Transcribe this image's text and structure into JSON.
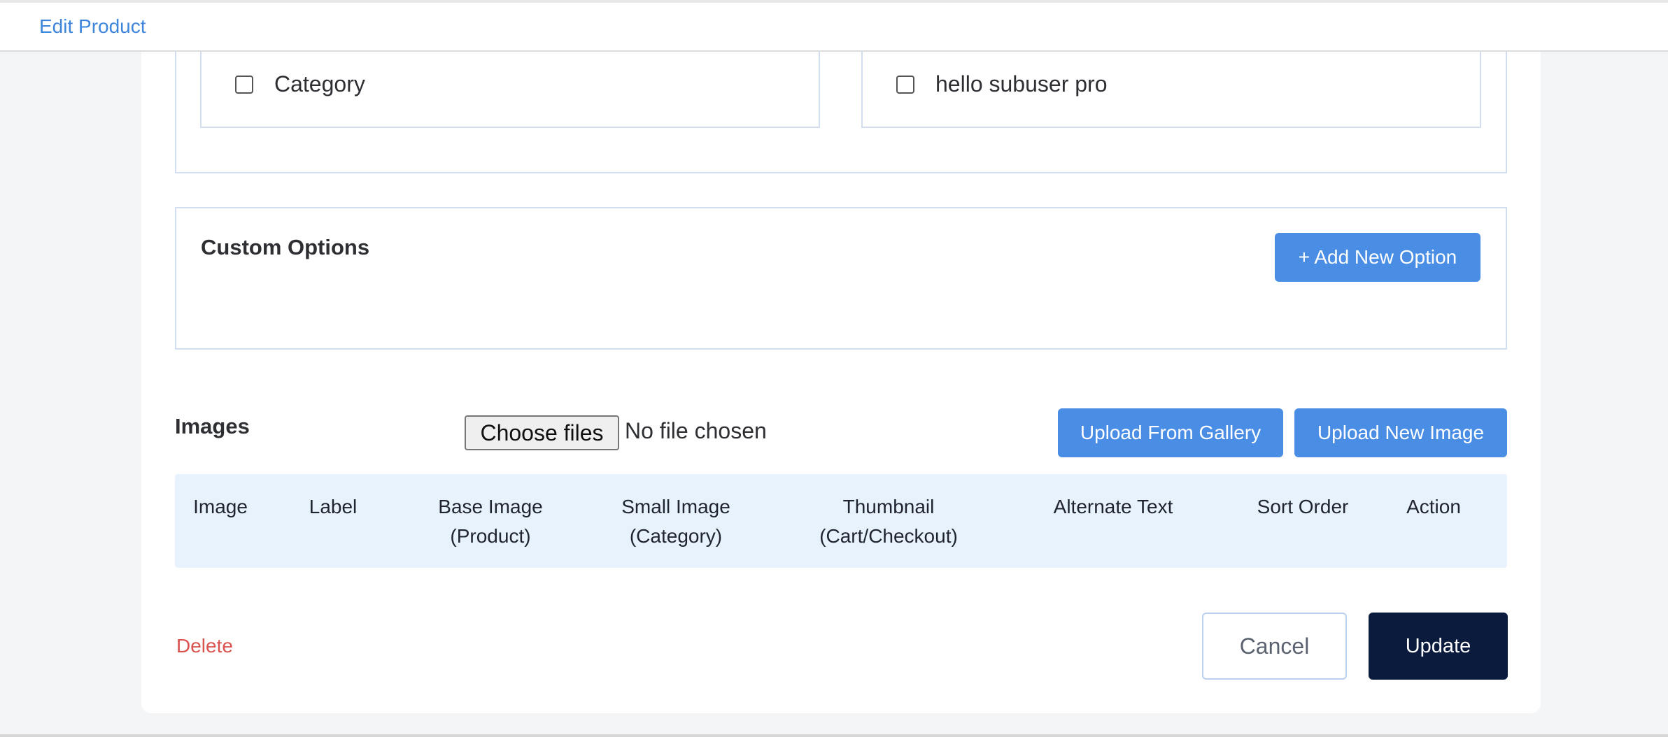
{
  "header": {
    "breadcrumb": "Edit Product"
  },
  "categories": {
    "items": [
      {
        "label": "Category",
        "checked": false
      },
      {
        "label": "hello subuser pro",
        "checked": false
      }
    ]
  },
  "custom_options": {
    "title": "Custom Options",
    "add_button": "+ Add New Option"
  },
  "images": {
    "title": "Images",
    "file_button": "Choose files",
    "file_status": "No file chosen",
    "upload_gallery_button": "Upload From Gallery",
    "upload_new_button": "Upload New Image",
    "columns": [
      "Image",
      "Label",
      "Base Image\n(Product)",
      "Small Image\n(Category)",
      "Thumbnail\n(Cart/Checkout)",
      "Alternate Text",
      "Sort Order",
      "Action"
    ]
  },
  "footer": {
    "delete_label": "Delete",
    "cancel_label": "Cancel",
    "update_label": "Update"
  },
  "colors": {
    "accent": "#4a8de4",
    "link": "#3d86dc",
    "danger": "#d9534f",
    "primary_dark": "#0b1b3d",
    "table_header_bg": "#e8f2fc"
  }
}
